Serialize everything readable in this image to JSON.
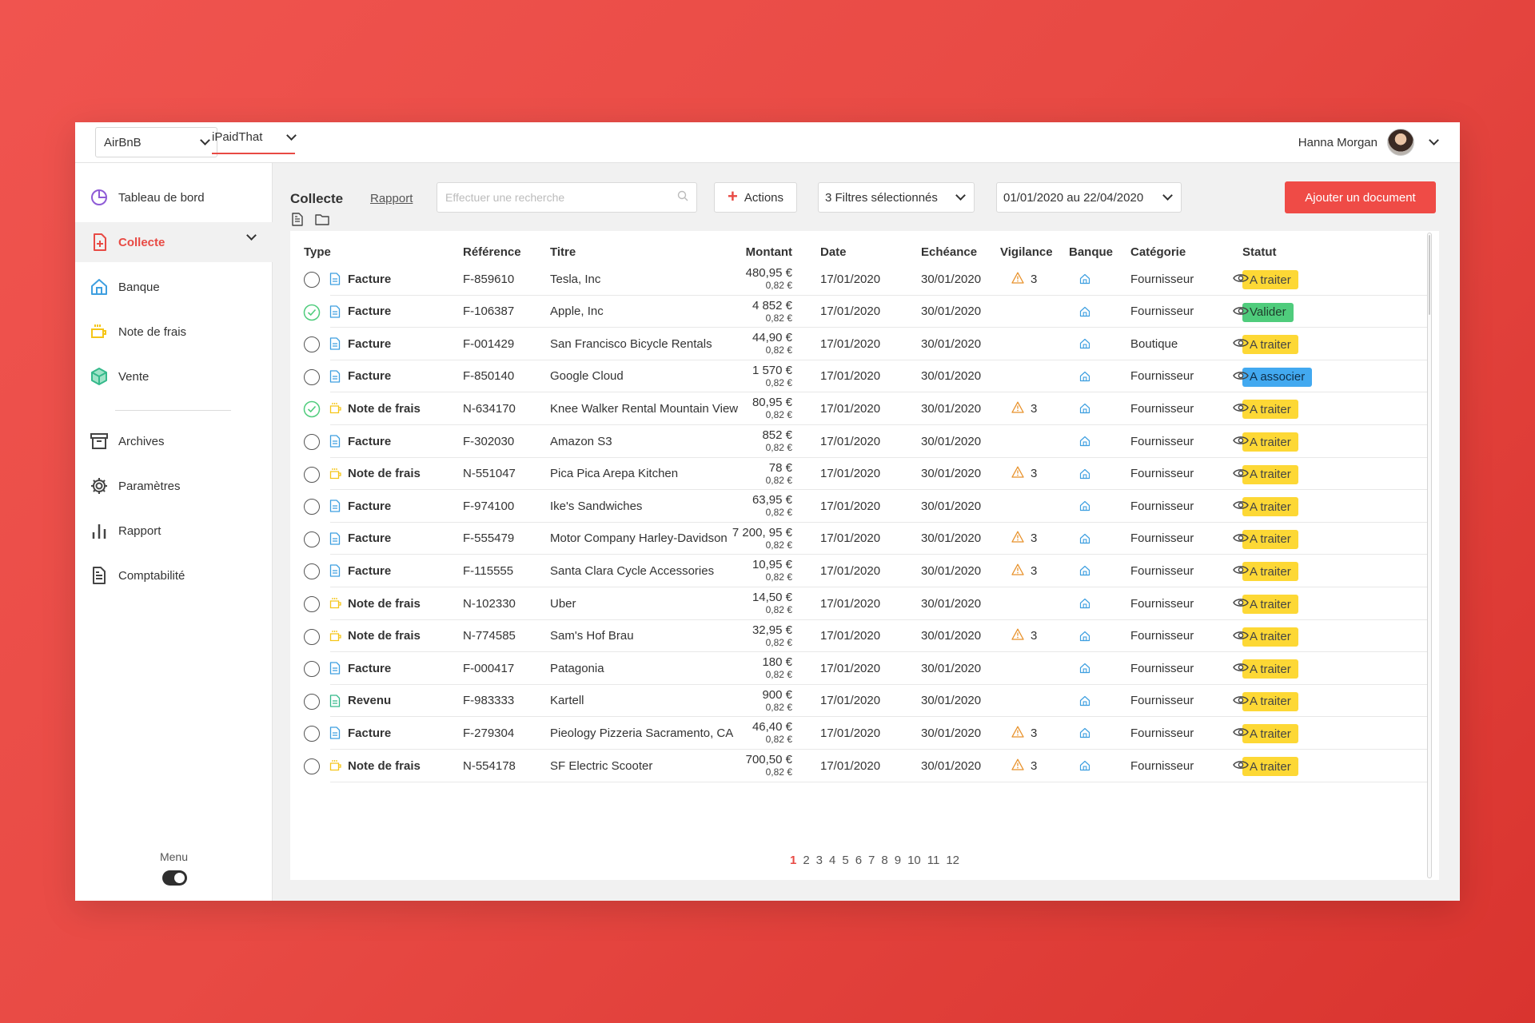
{
  "topbar": {
    "company_select": "AirBnB",
    "app_select": "iPaidThat",
    "user_name": "Hanna Morgan"
  },
  "sidebar": {
    "items": [
      {
        "label": "Tableau de bord",
        "icon": "dashboard-pie-icon"
      },
      {
        "label": "Collecte",
        "icon": "collect-doc-icon"
      },
      {
        "label": "Banque",
        "icon": "bank-icon"
      },
      {
        "label": "Note de frais",
        "icon": "coffee-cup-icon"
      },
      {
        "label": "Vente",
        "icon": "box-icon"
      },
      {
        "label": "Archives",
        "icon": "archive-icon"
      },
      {
        "label": "Paramètres",
        "icon": "gear-icon"
      },
      {
        "label": "Rapport",
        "icon": "bar-chart-icon"
      },
      {
        "label": "Comptabilité",
        "icon": "accounting-doc-icon"
      }
    ],
    "menu_label": "Menu"
  },
  "toolbar": {
    "title": "Collecte",
    "report_link": "Rapport",
    "search_placeholder": "Effectuer une recherche",
    "actions_label": "Actions",
    "filters_label": "3 Filtres sélectionnés",
    "date_range": "01/01/2020 au 22/04/2020",
    "add_label": "Ajouter un document"
  },
  "colors": {
    "accent": "#e84a44",
    "status_traiter": "#fdd835",
    "status_valider": "#4fcc7c",
    "status_associer": "#42a9f0"
  },
  "table": {
    "headers": {
      "type": "Type",
      "reference": "Référence",
      "titre": "Titre",
      "montant": "Montant",
      "date": "Date",
      "echeance": "Echéance",
      "vigilance": "Vigilance",
      "banque": "Banque",
      "categorie": "Catégorie",
      "statut": "Statut"
    },
    "rows": [
      {
        "checked": false,
        "type": "Facture",
        "kind": "invoice",
        "ref": "F-859610",
        "titre": "Tesla, Inc",
        "montant": "480,95 €",
        "tva": "0,82 €",
        "date": "17/01/2020",
        "echeance": "30/01/2020",
        "vigilance": "3",
        "categorie": "Fournisseur",
        "statut": "A traiter",
        "statut_kind": "traiter"
      },
      {
        "checked": true,
        "type": "Facture",
        "kind": "invoice",
        "ref": "F-106387",
        "titre": "Apple, Inc",
        "montant": "4 852 €",
        "tva": "0,82 €",
        "date": "17/01/2020",
        "echeance": "30/01/2020",
        "vigilance": "",
        "categorie": "Fournisseur",
        "statut": "Valider",
        "statut_kind": "valider"
      },
      {
        "checked": false,
        "type": "Facture",
        "kind": "invoice",
        "ref": "F-001429",
        "titre": "San Francisco Bicycle Rentals",
        "montant": "44,90 €",
        "tva": "0,82 €",
        "date": "17/01/2020",
        "echeance": "30/01/2020",
        "vigilance": "",
        "categorie": "Boutique",
        "statut": "A traiter",
        "statut_kind": "traiter"
      },
      {
        "checked": false,
        "type": "Facture",
        "kind": "invoice",
        "ref": "F-850140",
        "titre": "Google Cloud",
        "montant": "1 570 €",
        "tva": "0,82 €",
        "date": "17/01/2020",
        "echeance": "30/01/2020",
        "vigilance": "",
        "categorie": "Fournisseur",
        "statut": "A associer",
        "statut_kind": "associer"
      },
      {
        "checked": true,
        "type": "Note de frais",
        "kind": "expense",
        "ref": "N-634170",
        "titre": "Knee Walker Rental Mountain View",
        "montant": "80,95 €",
        "tva": "0,82 €",
        "date": "17/01/2020",
        "echeance": "30/01/2020",
        "vigilance": "3",
        "categorie": "Fournisseur",
        "statut": "A traiter",
        "statut_kind": "traiter"
      },
      {
        "checked": false,
        "type": "Facture",
        "kind": "invoice",
        "ref": "F-302030",
        "titre": "Amazon S3",
        "montant": "852 €",
        "tva": "0,82 €",
        "date": "17/01/2020",
        "echeance": "30/01/2020",
        "vigilance": "",
        "categorie": "Fournisseur",
        "statut": "A traiter",
        "statut_kind": "traiter"
      },
      {
        "checked": false,
        "type": "Note de frais",
        "kind": "expense",
        "ref": "N-551047",
        "titre": "Pica Pica Arepa Kitchen",
        "montant": "78 €",
        "tva": "0,82 €",
        "date": "17/01/2020",
        "echeance": "30/01/2020",
        "vigilance": "3",
        "categorie": "Fournisseur",
        "statut": "A traiter",
        "statut_kind": "traiter"
      },
      {
        "checked": false,
        "type": "Facture",
        "kind": "invoice",
        "ref": "F-974100",
        "titre": "Ike's Sandwiches",
        "montant": "63,95 €",
        "tva": "0,82 €",
        "date": "17/01/2020",
        "echeance": "30/01/2020",
        "vigilance": "",
        "categorie": "Fournisseur",
        "statut": "A traiter",
        "statut_kind": "traiter"
      },
      {
        "checked": false,
        "type": "Facture",
        "kind": "invoice",
        "ref": "F-555479",
        "titre": "Motor Company Harley-Davidson",
        "montant": "7 200, 95 €",
        "tva": "0,82 €",
        "date": "17/01/2020",
        "echeance": "30/01/2020",
        "vigilance": "3",
        "categorie": "Fournisseur",
        "statut": "A traiter",
        "statut_kind": "traiter"
      },
      {
        "checked": false,
        "type": "Facture",
        "kind": "invoice",
        "ref": "F-115555",
        "titre": "Santa Clara Cycle Accessories",
        "montant": "10,95 €",
        "tva": "0,82 €",
        "date": "17/01/2020",
        "echeance": "30/01/2020",
        "vigilance": "3",
        "categorie": "Fournisseur",
        "statut": "A traiter",
        "statut_kind": "traiter"
      },
      {
        "checked": false,
        "type": "Note de frais",
        "kind": "expense",
        "ref": "N-102330",
        "titre": "Uber",
        "montant": "14,50 €",
        "tva": "0,82 €",
        "date": "17/01/2020",
        "echeance": "30/01/2020",
        "vigilance": "",
        "categorie": "Fournisseur",
        "statut": "A traiter",
        "statut_kind": "traiter"
      },
      {
        "checked": false,
        "type": "Note de frais",
        "kind": "expense",
        "ref": "N-774585",
        "titre": "Sam's Hof Brau",
        "montant": "32,95 €",
        "tva": "0,82 €",
        "date": "17/01/2020",
        "echeance": "30/01/2020",
        "vigilance": "3",
        "categorie": "Fournisseur",
        "statut": "A traiter",
        "statut_kind": "traiter"
      },
      {
        "checked": false,
        "type": "Facture",
        "kind": "invoice",
        "ref": "F-000417",
        "titre": "Patagonia",
        "montant": "180 €",
        "tva": "0,82 €",
        "date": "17/01/2020",
        "echeance": "30/01/2020",
        "vigilance": "",
        "categorie": "Fournisseur",
        "statut": "A traiter",
        "statut_kind": "traiter"
      },
      {
        "checked": false,
        "type": "Revenu",
        "kind": "revenue",
        "ref": "F-983333",
        "titre": "Kartell",
        "montant": "900 €",
        "tva": "0,82 €",
        "date": "17/01/2020",
        "echeance": "30/01/2020",
        "vigilance": "",
        "categorie": "Fournisseur",
        "statut": "A traiter",
        "statut_kind": "traiter"
      },
      {
        "checked": false,
        "type": "Facture",
        "kind": "invoice",
        "ref": "F-279304",
        "titre": "Pieology Pizzeria Sacramento, CA",
        "montant": "46,40 €",
        "tva": "0,82 €",
        "date": "17/01/2020",
        "echeance": "30/01/2020",
        "vigilance": "3",
        "categorie": "Fournisseur",
        "statut": "A traiter",
        "statut_kind": "traiter"
      },
      {
        "checked": false,
        "type": "Note de frais",
        "kind": "expense",
        "ref": "N-554178",
        "titre": "SF Electric Scooter",
        "montant": "700,50 €",
        "tva": "0,82 €",
        "date": "17/01/2020",
        "echeance": "30/01/2020",
        "vigilance": "3",
        "categorie": "Fournisseur",
        "statut": "A traiter",
        "statut_kind": "traiter"
      }
    ]
  },
  "pagination": {
    "pages": [
      "1",
      "2",
      "3",
      "4",
      "5",
      "6",
      "7",
      "8",
      "9",
      "10",
      "11",
      "12"
    ],
    "current": "1"
  }
}
